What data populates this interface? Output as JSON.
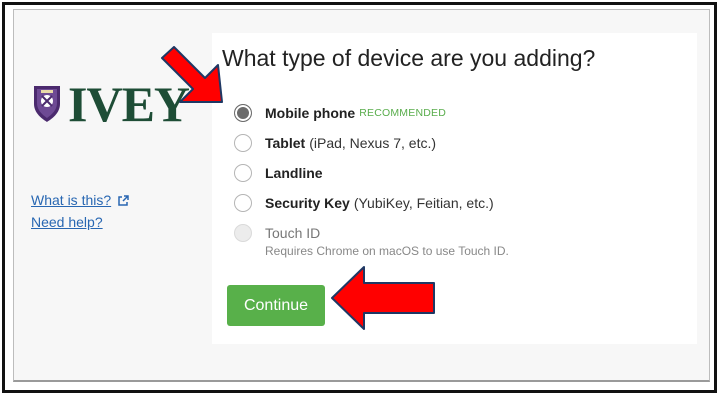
{
  "sidebar": {
    "logo_text": "IVEY",
    "links": [
      {
        "label": "What is this?"
      },
      {
        "label": "Need help?"
      }
    ]
  },
  "main": {
    "title": "What type of device are you adding?",
    "options": [
      {
        "label": "Mobile phone",
        "badge": "RECOMMENDED",
        "detail": "",
        "state": "selected"
      },
      {
        "label": "Tablet",
        "detail": "(iPad, Nexus 7, etc.)",
        "state": "unselected"
      },
      {
        "label": "Landline",
        "detail": "",
        "state": "unselected"
      },
      {
        "label": "Security Key",
        "detail": "(YubiKey, Feitian, etc.)",
        "state": "unselected"
      },
      {
        "label": "Touch ID",
        "detail": "",
        "state": "disabled"
      }
    ],
    "touch_id_hint": "Requires Chrome on macOS to use Touch ID.",
    "continue_label": "Continue"
  },
  "colors": {
    "accent_green": "#58b04a",
    "recommended_green": "#59ad4c",
    "link_blue": "#2867b2",
    "logo_green": "#1e4d36",
    "arrow_red": "#ff0000"
  }
}
